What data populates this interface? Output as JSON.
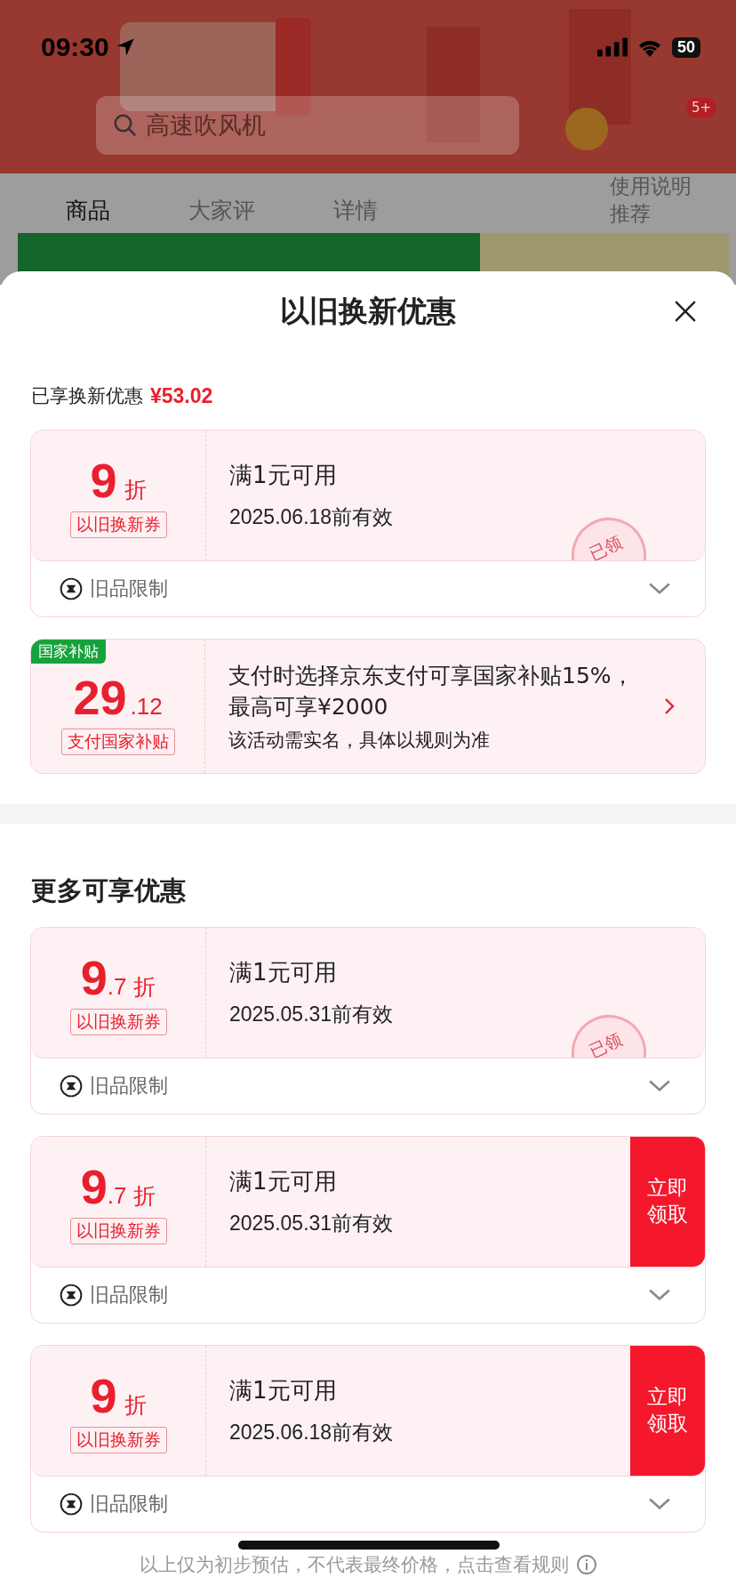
{
  "status_bar": {
    "time": "09:30",
    "battery": "50"
  },
  "background_page": {
    "search": {
      "placeholder": "高速吹风机"
    },
    "cart_badge": "5+",
    "tabs": [
      {
        "label": "商品",
        "selected": true
      },
      {
        "label": "大家评",
        "selected": false
      },
      {
        "label": "详情",
        "selected": false
      }
    ],
    "guide": "使用说明",
    "recommend": "推荐"
  },
  "sheet": {
    "title": "以旧换新优惠",
    "enjoyed": {
      "label": "已享换新优惠",
      "amount": "¥53.02"
    },
    "offers": [
      {
        "kind": "coupon",
        "value": "9",
        "unit": "折",
        "tag": "以旧换新券",
        "condition": "满1元可用",
        "validity": "2025.06.18前有效",
        "claimed": true,
        "stamp": "已领",
        "restriction": "旧品限制"
      },
      {
        "kind": "subsidy",
        "badge": "国家补贴",
        "value": "29",
        "decimal": ".12",
        "tag": "支付国家补贴",
        "description": "支付时选择京东支付可享国家补贴15%，最高可享¥2000",
        "note": "该活动需实名，具体以规则为准"
      }
    ],
    "more_title": "更多可享优惠",
    "more_offers": [
      {
        "kind": "coupon",
        "value": "9",
        "decimal": ".7",
        "unit": "折",
        "tag": "以旧换新券",
        "condition": "满1元可用",
        "validity": "2025.05.31前有效",
        "claimed": true,
        "stamp": "已领",
        "restriction": "旧品限制"
      },
      {
        "kind": "coupon",
        "value": "9",
        "decimal": ".7",
        "unit": "折",
        "tag": "以旧换新券",
        "condition": "满1元可用",
        "validity": "2025.05.31前有效",
        "claimed": false,
        "button": "立即领取",
        "restriction": "旧品限制"
      },
      {
        "kind": "coupon",
        "value": "9",
        "unit": "折",
        "tag": "以旧换新券",
        "condition": "满1元可用",
        "validity": "2025.06.18前有效",
        "claimed": false,
        "button": "立即领取",
        "restriction": "旧品限制"
      }
    ],
    "footer": "以上仅为初步预估，不代表最终价格，点击查看规则"
  }
}
